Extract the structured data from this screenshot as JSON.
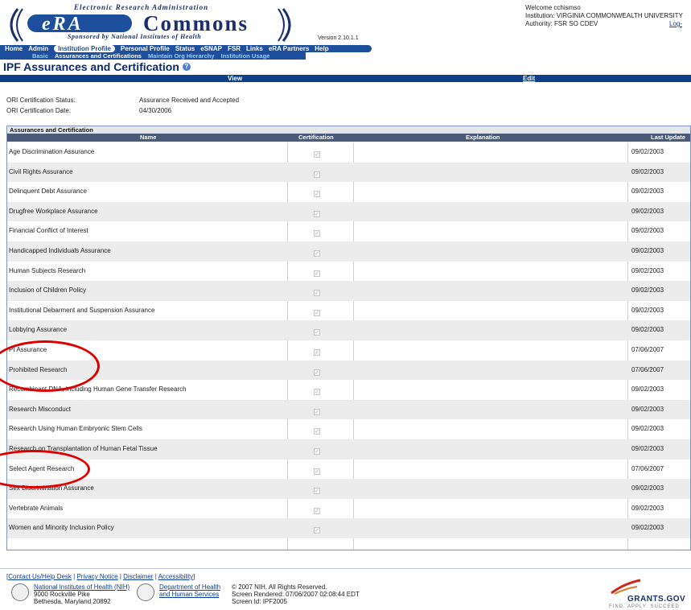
{
  "header": {
    "tagline_top": "Electronic Research Administration",
    "era": "eRA",
    "commons": "Commons",
    "tagline_bottom": "Sponsored by National Institutes of Health",
    "version": "Version 2.10.1.1",
    "welcome": "Welcome cchismso",
    "institution": "Institution: VIRGINIA COMMONWEALTH UNIVERSITY",
    "authority": "Authority:  FSR  SO  CDEV",
    "logout": "Log-"
  },
  "nav": {
    "main": [
      "Home",
      "Admin",
      "Institution Profile",
      "Personal Profile",
      "Status",
      "eSNAP",
      "FSR",
      "Links",
      "eRA Partners",
      "Help"
    ],
    "active_main": "Institution Profile",
    "sub": [
      "Basic",
      "Assurances and Certifications",
      "Maintain Org Hierarchy",
      "Institution Usage"
    ],
    "active_sub": "Assurances and Certifications"
  },
  "page": {
    "title": "IPF Assurances and Certification",
    "tab_view": "View",
    "tab_edit": "Edit",
    "ori_status_label": "ORI Certification Status:",
    "ori_status_value": "Assurance Received and Accepted",
    "ori_date_label": "ORI Certification Date:",
    "ori_date_value": "04/30/2006"
  },
  "table": {
    "caption": "Assurances and Certification",
    "columns": [
      "Name",
      "Certification",
      "Explanation",
      "Last Update"
    ],
    "rows": [
      {
        "name": "Age Discrimination Assurance",
        "date": "09/02/2003"
      },
      {
        "name": "Civil Rights Assurance",
        "date": "09/02/2003"
      },
      {
        "name": "Delinquent Debt Assurance",
        "date": "09/02/2003"
      },
      {
        "name": "Drugfree Workplace Assurance",
        "date": "09/02/2003"
      },
      {
        "name": "Financial Conflict of Interest",
        "date": "09/02/2003"
      },
      {
        "name": "Handicapped Individuals Assurance",
        "date": "09/02/2003"
      },
      {
        "name": "Human Subjects Research",
        "date": "09/02/2003"
      },
      {
        "name": "Inclusion of Children Policy",
        "date": "09/02/2003"
      },
      {
        "name": "Institutional Debarment and Suspension Assurance",
        "date": "09/02/2003"
      },
      {
        "name": "Lobbying Assurance",
        "date": "09/02/2003"
      },
      {
        "name": "PI Assurance",
        "date": "07/06/2007"
      },
      {
        "name": "Prohibited Research",
        "date": "07/06/2007"
      },
      {
        "name": "Recombinant DNA, Including Human Gene Transfer Research",
        "date": "09/02/2003"
      },
      {
        "name": "Research Misconduct",
        "date": "09/02/2003"
      },
      {
        "name": "Research Using Human Embryonic Stem Cells",
        "date": "09/02/2003"
      },
      {
        "name": "Research on Transplantation of Human Fetal Tissue",
        "date": "09/02/2003"
      },
      {
        "name": "Select Agent Research",
        "date": "07/06/2007"
      },
      {
        "name": "Sex Discrimination Assurance",
        "date": "09/02/2003"
      },
      {
        "name": "Vertebrate Animals",
        "date": "09/02/2003"
      },
      {
        "name": "Women and Minority Inclusion Policy",
        "date": "09/02/2003"
      }
    ]
  },
  "footer": {
    "links": [
      "Contact Us/Help Desk",
      "Privacy Notice",
      "Disclaimer",
      "Accessibility"
    ],
    "nih_name": "National Institutes of Health (NIH)",
    "nih_addr1": "9000 Rockville Pike",
    "nih_addr2": "Bethesda, Maryland 20892",
    "hhs_line1": "Department of Health",
    "hhs_line2": "and Human Services",
    "copyright": "© 2007 NIH. All Rights Reserved.",
    "rendered": "Screen Rendered: 07/06/2007 02:08:44 EDT",
    "screen_id": "Screen Id: IPF2005",
    "grants": "GRANTS.GOV",
    "grants_tag": "FIND. APPLY. SUCCEED"
  },
  "colors": {
    "nav_blue": "#1d4f9c",
    "title_blue": "#0a2a6c",
    "annotation_red": "#dd0000"
  }
}
